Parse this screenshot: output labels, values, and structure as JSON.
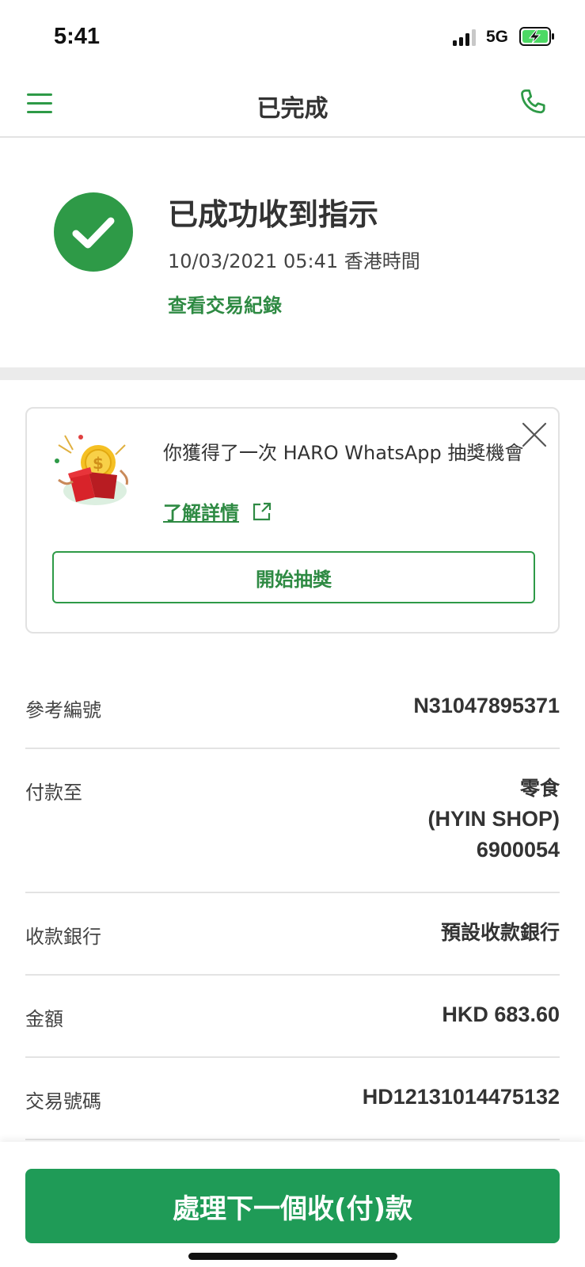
{
  "status_bar": {
    "time": "5:41",
    "network": "5G",
    "icons": [
      "signal-icon",
      "battery-charging-icon"
    ]
  },
  "nav": {
    "title": "已完成",
    "left_icon": "menu-icon",
    "right_icon": "phone-icon"
  },
  "success": {
    "icon": "check-circle-icon",
    "title": "已成功收到指示",
    "timestamp": "10/03/2021 05:41 香港時間",
    "history_link": "查看交易紀錄"
  },
  "promo": {
    "illustration": "gift-coin-icon",
    "message": "你獲得了一次 HARO WhatsApp 抽獎機會",
    "link": "了解詳情",
    "link_icon": "external-link-icon",
    "close_icon": "close-icon",
    "button": "開始抽獎"
  },
  "details": {
    "reference": {
      "label": "參考編號",
      "value": "N31047895371"
    },
    "payee": {
      "label": "付款至",
      "name": "零食",
      "shop": "(HYIN SHOP)",
      "account": "6900054"
    },
    "bank": {
      "label": "收款銀行",
      "value": "預設收款銀行"
    },
    "amount": {
      "label": "金額",
      "value": "HKD 683.60"
    },
    "transaction": {
      "label": "交易號碼",
      "value": "HD12131014475132"
    }
  },
  "bottom": {
    "button": "處理下一個收(付)款"
  },
  "colors": {
    "brand_green": "#2e9a47",
    "button_green": "#1f9b57",
    "divider": "#e3e3e3"
  }
}
